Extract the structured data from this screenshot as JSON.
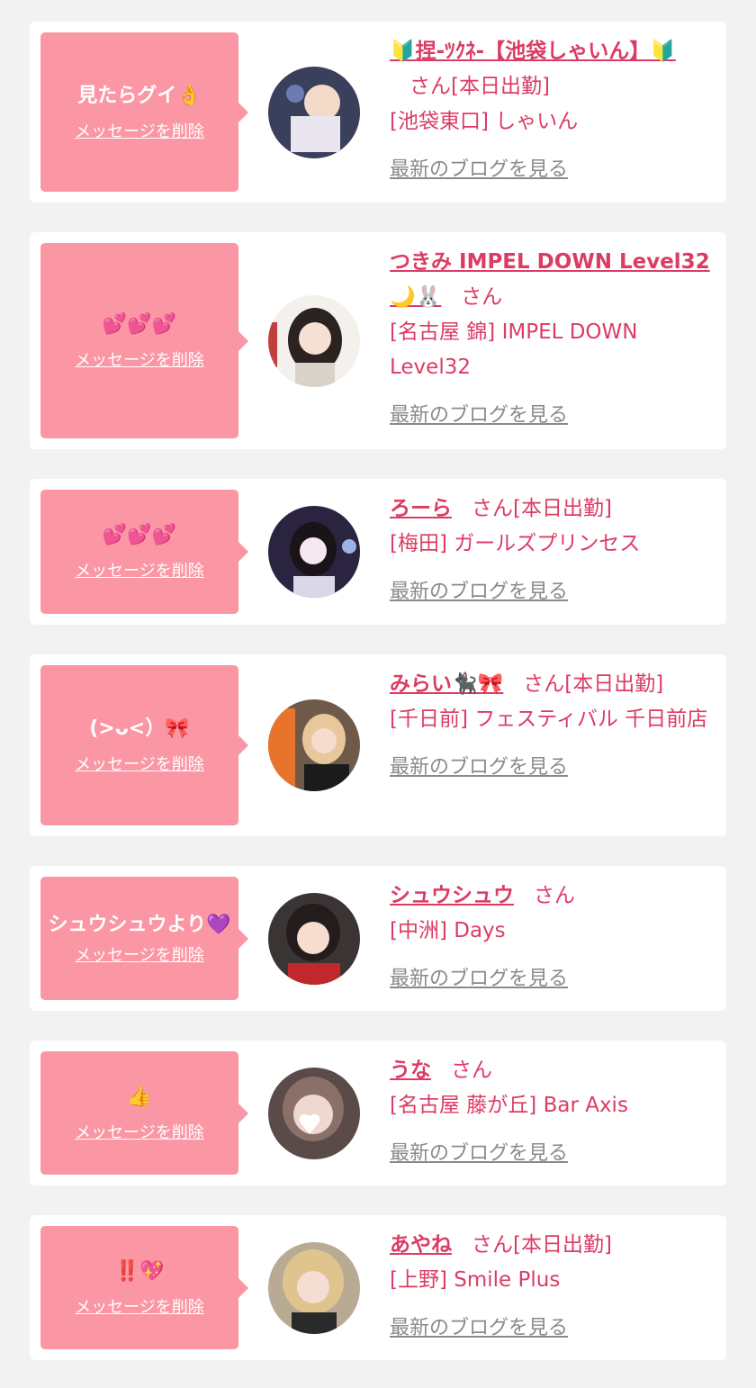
{
  "delete_label": "メッセージを削除",
  "blog_label": "最新のブログを見る",
  "san_label": "さん",
  "colors": {
    "accent_pink": "#fb96a5",
    "text_pink": "#dc3c64",
    "link_gray": "#8a8a8a",
    "background": "#f2f2f2"
  },
  "items": [
    {
      "message": "見たらグイ👌",
      "name": "🔰捏-ﾂｸﾈ-【池袋しゃいん】🔰",
      "status": "[本日出勤]",
      "shop": "[池袋東口] しゃいん"
    },
    {
      "message": "💕💕💕",
      "name": "つきみ IMPEL DOWN Level32🌙🐰",
      "status": "",
      "shop": "[名古屋 錦] IMPEL DOWN Level32"
    },
    {
      "message": "💕💕💕",
      "name": "ろーら",
      "status": "[本日出勤]",
      "shop": "[梅田] ガールズプリンセス"
    },
    {
      "message": "(>ᴗ<）🎀",
      "name": "みらい🐈‍⬛🎀",
      "status": "[本日出勤]",
      "shop": "[千日前] フェスティバル 千日前店"
    },
    {
      "message": "シュウシュウより💜",
      "name": "シュウシュウ",
      "status": "",
      "shop": "[中洲] Days"
    },
    {
      "message": "👍",
      "name": "うな",
      "status": "",
      "shop": "[名古屋 藤が丘] Bar Axis"
    },
    {
      "message": "‼️💖",
      "name": "あやね",
      "status": "[本日出勤]",
      "shop": "[上野] Smile Plus"
    }
  ]
}
